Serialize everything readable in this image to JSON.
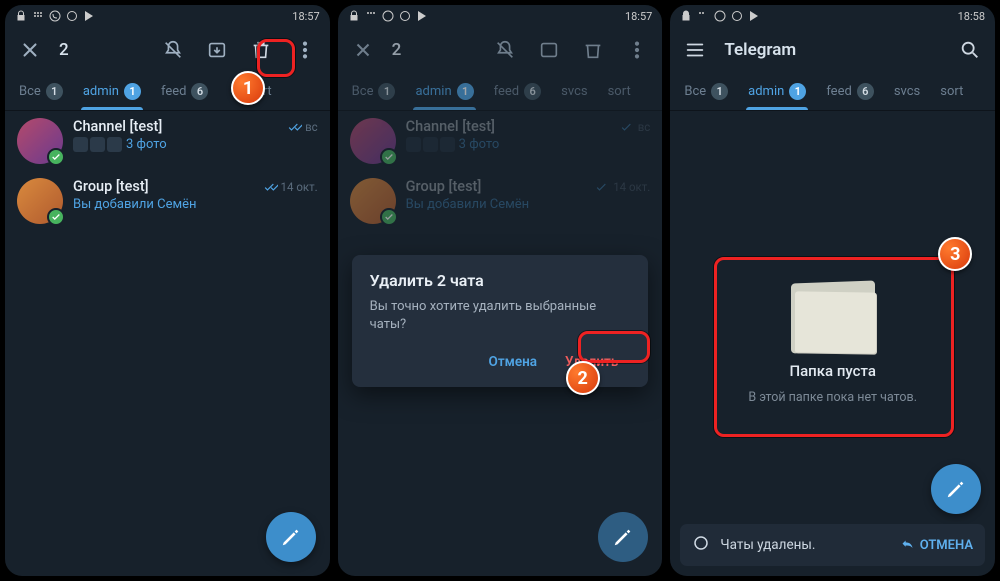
{
  "status": {
    "time1": "18:57",
    "time2": "18:58"
  },
  "appbar": {
    "selected_count": "2",
    "app_title": "Telegram"
  },
  "tabs": {
    "all": "Все",
    "all_badge": "1",
    "admin": "admin",
    "admin_badge": "1",
    "feed": "feed",
    "feed_badge": "6",
    "svcs": "svcs",
    "sort": "sort"
  },
  "chats": {
    "c1": {
      "name": "Channel [test]",
      "preview_suffix": "3 фото",
      "time": "вс"
    },
    "c2": {
      "name": "Group [test]",
      "preview": "Вы добавили Семён",
      "time": "14 окт."
    }
  },
  "dialog": {
    "title": "Удалить 2 чата",
    "text": "Вы точно хотите удалить выбранные чаты?",
    "cancel": "Отмена",
    "delete": "Удалить"
  },
  "empty": {
    "title": "Папка пуста",
    "sub": "В этой папке пока нет чатов."
  },
  "snackbar": {
    "text": "Чаты удалены.",
    "undo": "ОТМЕНА"
  },
  "steps": {
    "s1": "1",
    "s2": "2",
    "s3": "3"
  }
}
